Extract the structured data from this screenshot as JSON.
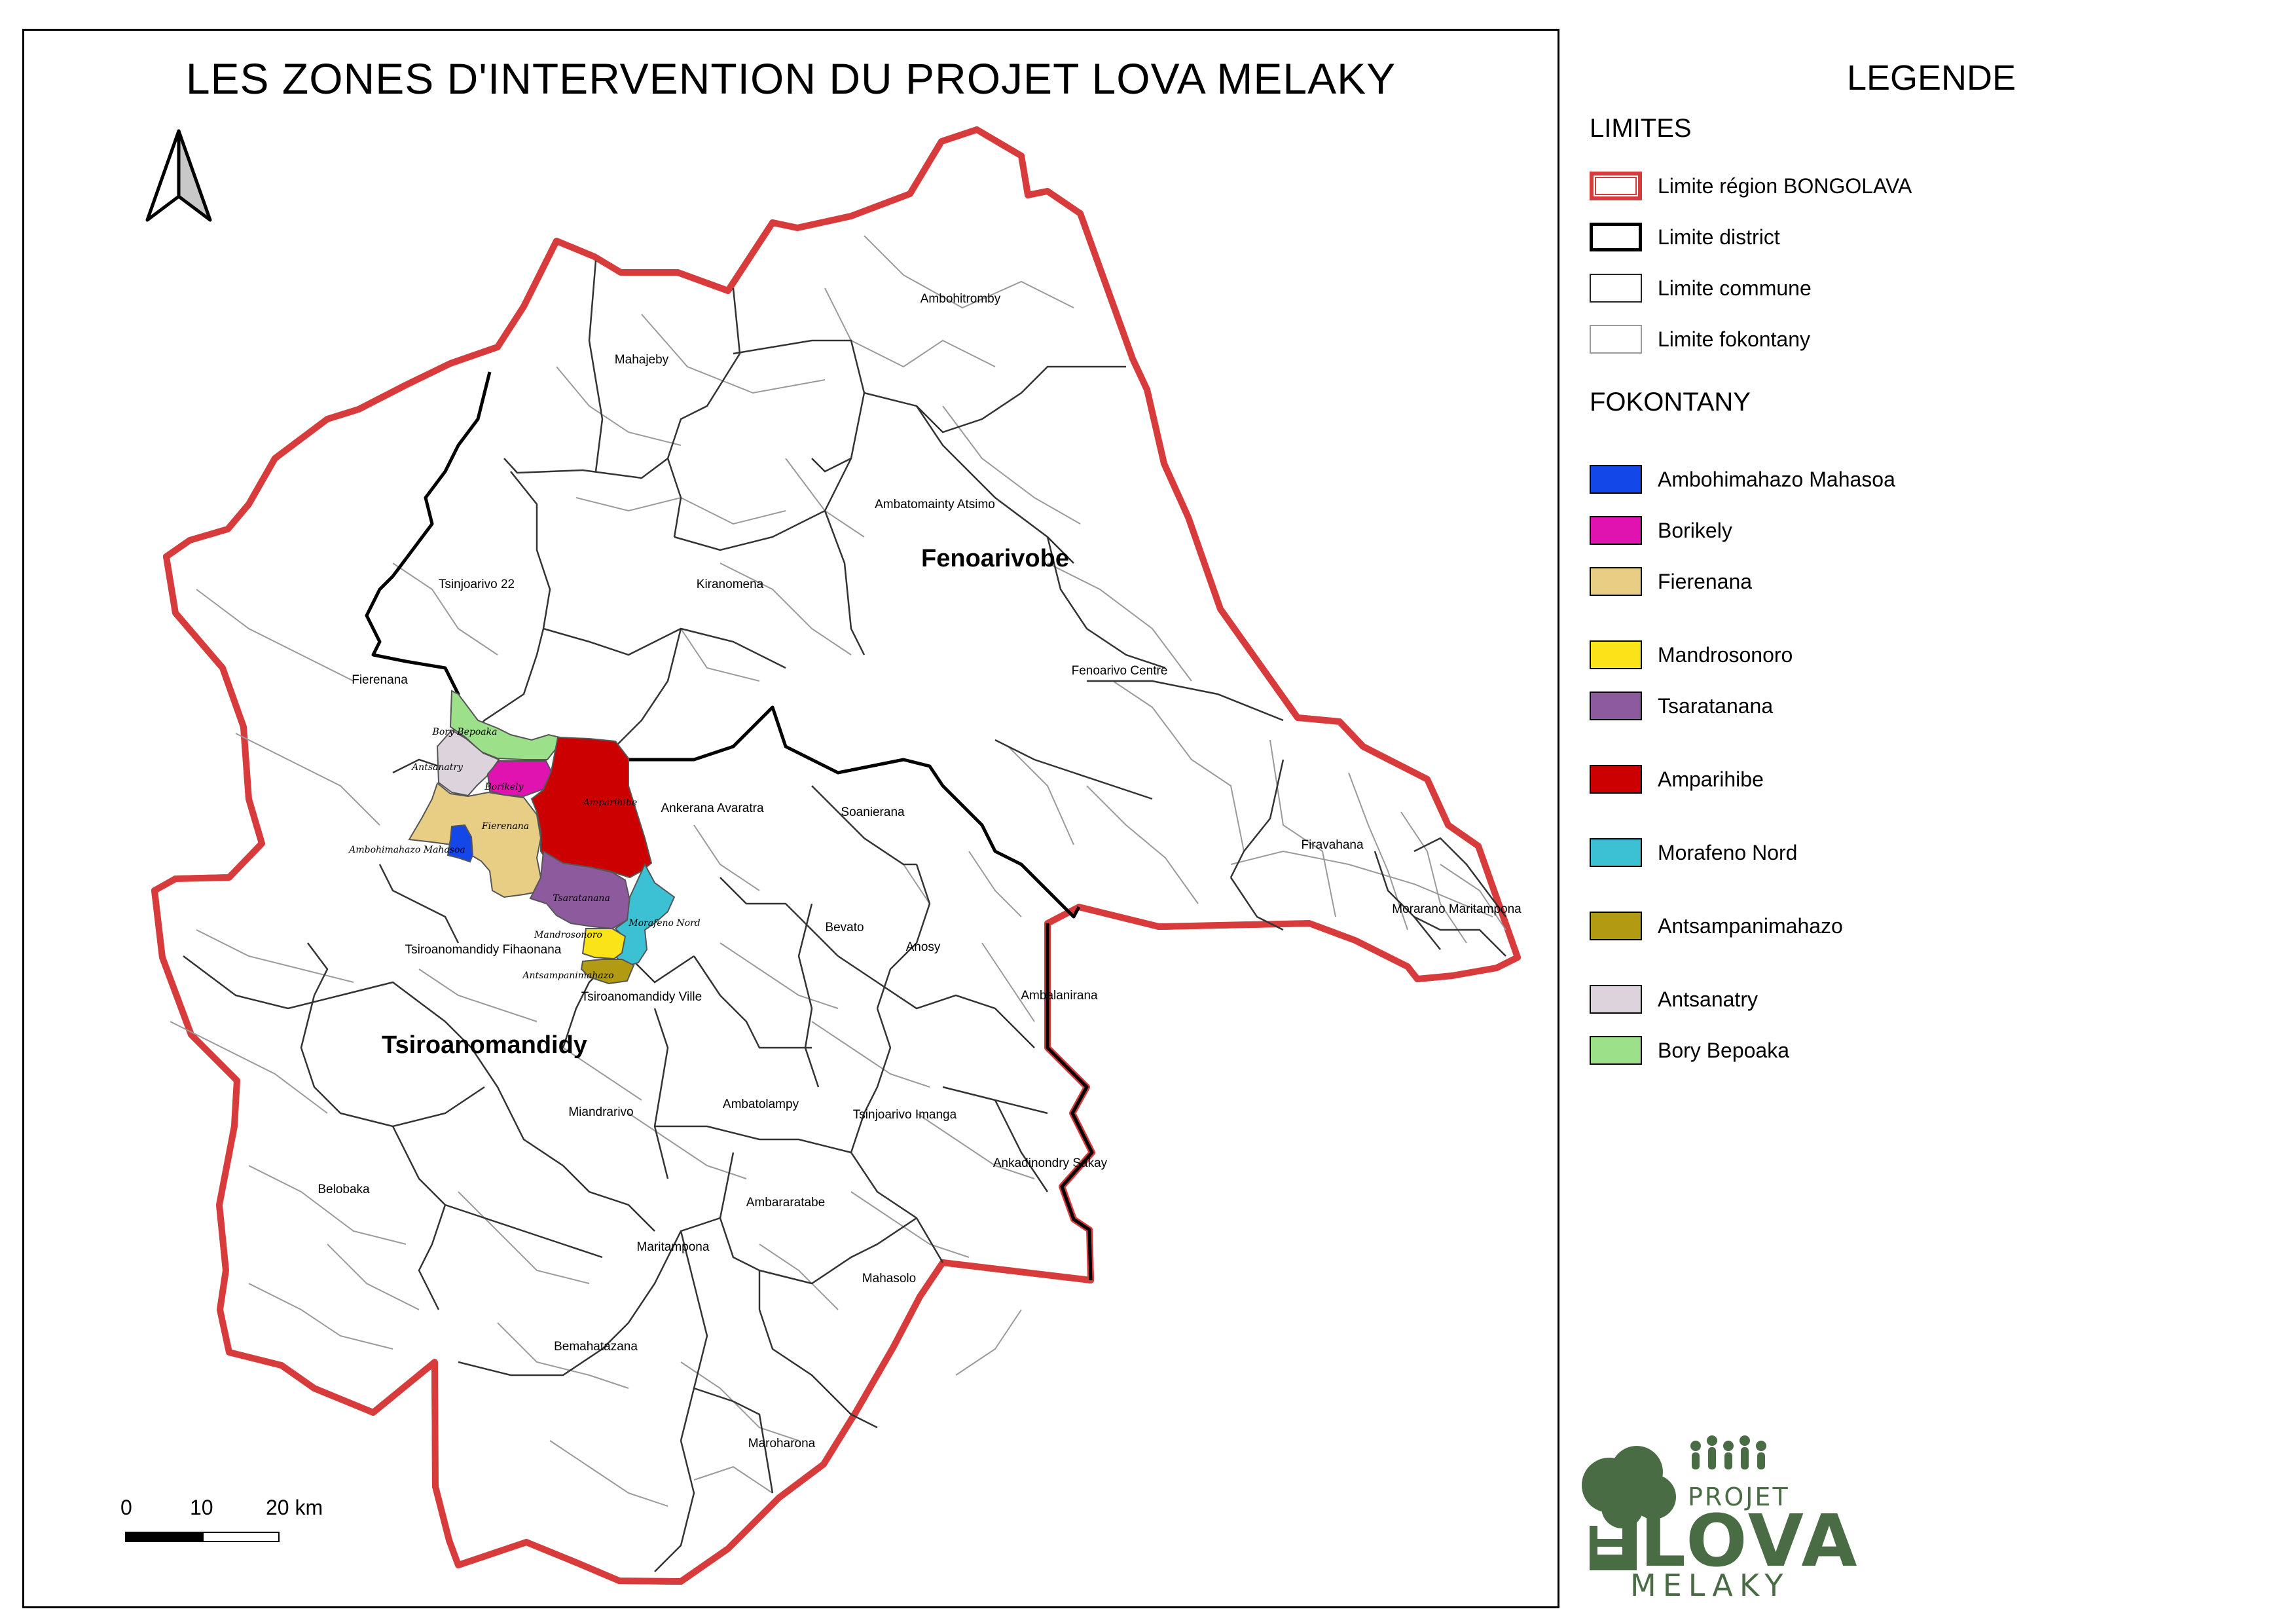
{
  "title": "LES ZONES D'INTERVENTION DU PROJET LOVA MELAKY",
  "legend": {
    "title": "LEGENDE",
    "limites_title": "LIMITES",
    "limites": [
      {
        "label": "Limite région BONGOLAVA",
        "color": "#d83b3b"
      },
      {
        "label": "Limite district",
        "color": "#000000"
      },
      {
        "label": "Limite commune",
        "color": "#222222"
      },
      {
        "label": "Limite fokontany",
        "color": "#9a9a9a"
      }
    ],
    "fokontany_title": "FOKONTANY",
    "fokontany": [
      {
        "label": "Ambohimahazo Mahasoa",
        "color": "#1347e8"
      },
      {
        "label": "Borikely",
        "color": "#e013b0"
      },
      {
        "label": "Fierenana",
        "color": "#e8cd85"
      },
      {
        "label": "Mandrosonoro",
        "color": "#fbe319"
      },
      {
        "label": "Tsaratanana",
        "color": "#8d5a9e"
      },
      {
        "label": "Amparihibe",
        "color": "#cc0000"
      },
      {
        "label": "Morafeno Nord",
        "color": "#3bc1d3"
      },
      {
        "label": "Antsampanimahazo",
        "color": "#b39a13"
      },
      {
        "label": "Antsanatry",
        "color": "#ddd3dd"
      },
      {
        "label": "Bory Bepoaka",
        "color": "#9de08a"
      }
    ]
  },
  "districts": [
    "Fenoarivobe",
    "Tsiroanomandidy"
  ],
  "communes": [
    "Ambohitromby",
    "Mahajeby",
    "Ambatomainty Atsimo",
    "Tsinjoarivo 22",
    "Kiranomena",
    "Fenoarivo Centre",
    "Fierenana",
    "Ankerana Avaratra",
    "Soanierana",
    "Firavahana",
    "Morarano Maritampona",
    "Tsiroanomandidy Fihaonana",
    "Bevato",
    "Anosy",
    "Tsiroanomandidy Ville",
    "Ambalanirana",
    "Ambatolampy",
    "Miandrarivo",
    "Tsinjoarivo Imanga",
    "Ankadinondry Sakay",
    "Belobaka",
    "Ambararatabe",
    "Maritampona",
    "Mahasolo",
    "Bemahatazana",
    "Maroharona"
  ],
  "fokontany_labels": [
    "Bory Bepoaka",
    "Antsanatry",
    "Borikely",
    "Amparihibe",
    "Fierenana",
    "Ambohimahazo Mahasoa",
    "Tsaratanana",
    "Mandrosonoro",
    "Morafeno Nord",
    "Antsampanimahazo"
  ],
  "scale": {
    "ticks": [
      "0",
      "10",
      "20 km"
    ]
  },
  "logo": {
    "line1": "PROJET",
    "line2": "LOVA",
    "line3": "MELAKY",
    "color": "#4a6c45"
  },
  "colors": {
    "region_boundary": "#d83b3b",
    "district_boundary": "#000000",
    "commune_boundary": "#333333",
    "fokontany_boundary": "#9a9a9a"
  }
}
